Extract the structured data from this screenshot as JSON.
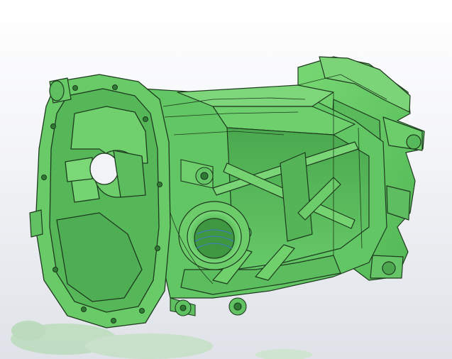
{
  "viewport": {
    "background_top": "#ffffff",
    "background_bottom": "#dfe2e8"
  },
  "model": {
    "body_color": "#5fc561",
    "shade_color": "#3f9a43",
    "highlight_color": "#8ee08a",
    "edge_color": "#1e3a1f",
    "reflection_color": "#9ed19a",
    "thread_color": "#3a7fb0"
  }
}
